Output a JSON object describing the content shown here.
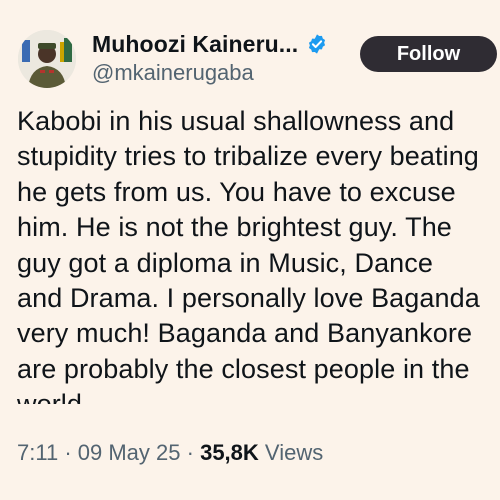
{
  "author": {
    "display_name": "Muhoozi Kaineru...",
    "handle": "@mkainerugaba",
    "verified_icon": "verified-badge-icon",
    "avatar_icon": "profile-avatar"
  },
  "follow_button": {
    "label": "Follow"
  },
  "tweet": {
    "lines": [
      "Kabobi in his usual shallowness and",
      "stupidity tries to tribalize every beating",
      "he gets from us. You have to excuse",
      "him. He is not the brightest guy. The",
      "guy got a diploma in Music, Dance",
      "and Drama. I personally love Baganda",
      "very much! Baganda and Banyankore",
      "are probably the closest people in the",
      "world."
    ]
  },
  "meta": {
    "time": "7:11",
    "separator": "·",
    "date": "09 May 25",
    "views_count": "35,8K",
    "views_label": "Views"
  },
  "colors": {
    "background": "#fcf3ea",
    "follow_bg": "#2f2c33",
    "verified": "#1d9bf0",
    "secondary_text": "#536471"
  }
}
